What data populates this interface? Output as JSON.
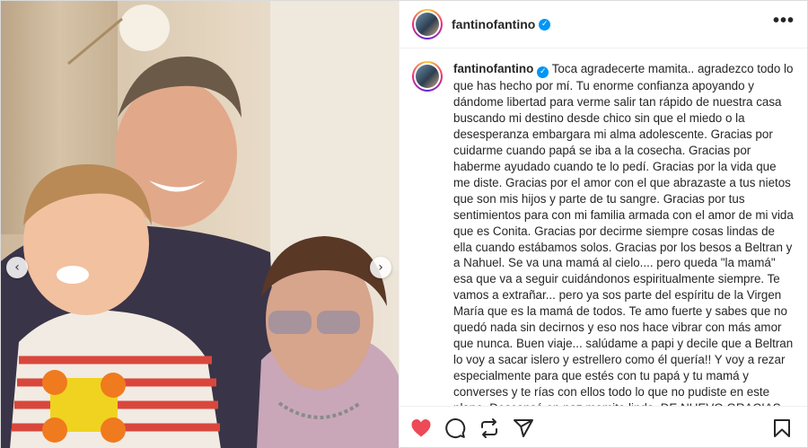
{
  "post": {
    "username": "fantinofantino",
    "verified": true,
    "more_label": "•••",
    "caption_user": "fantinofantino",
    "caption_text": " Toca agradecerte mamita.. agradezco todo lo que has hecho por mí. Tu enorme confianza apoyando y dándome libertad para verme salir tan rápido de nuestra casa buscando mi destino desde chico sin que el miedo o la desesperanza embargara mi alma adolescente. Gracias por cuidarme cuando papá se iba a la cosecha. Gracias por haberme ayudado cuando te lo pedí. Gracias por la vida que me diste. Gracias por el amor con el que abrazaste a tus nietos que son mis hijos y parte de tu sangre. Gracias por tus sentimientos para con mi familia armada con el amor de mi vida que es Conita. Gracias por decirme siempre cosas lindas de ella cuando estábamos solos. Gracias por los besos a Beltran y a Nahuel. Se va una mamá al cielo.... pero queda \"la mamá\" esa que va a seguir cuidándonos espiritualmente siempre. Te vamos a extrañar... pero ya sos parte del espíritu de la Virgen María que es la mamá de todos. Te amo fuerte y sabes que no quedó nada sin decirnos y eso nos hace vibrar con más amor que nunca. Buen viaje... salúdame a papi y decile que a Beltran lo voy a sacar islero y estrellero como él quería!! Y voy a rezar especialmente para que estés con tu papá y tu mamá y converses y te rías con ellos todo lo que no pudiste en este plano. Descansá en paz mamita linda, DE NUEVO GRACIAS POR TODO CHITA ",
    "caption_hearts_inline": "♥ ♥ ♥",
    "caption_hearts_row": "♥♥♥♥♥♥♥♥♥"
  },
  "media": {
    "prev_arrow": "‹",
    "next_arrow": "›"
  },
  "icons": {
    "like": "heart-filled-icon",
    "comment": "comment-icon",
    "share": "repost-icon",
    "send": "send-icon",
    "save": "bookmark-icon",
    "verified": "verified-badge-icon"
  },
  "colors": {
    "like": "#ed4956",
    "verified": "#0095f6",
    "text": "#262626"
  }
}
